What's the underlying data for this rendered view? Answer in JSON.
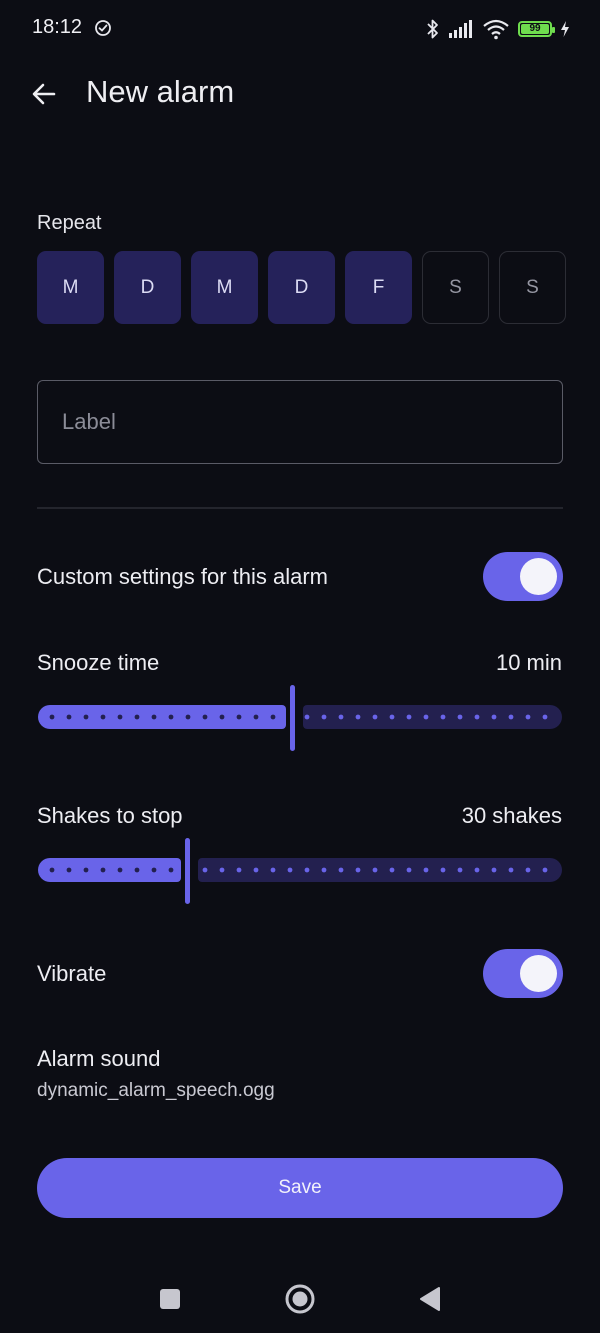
{
  "status_bar": {
    "time": "18:12",
    "battery": "99",
    "icons": [
      "check-circle-icon",
      "bluetooth-icon",
      "signal-icon",
      "wifi-icon",
      "battery-icon",
      "charging-icon"
    ]
  },
  "header": {
    "title": "New alarm",
    "back_icon": "arrow-left-icon"
  },
  "repeat": {
    "label": "Repeat",
    "days": [
      {
        "label": "M",
        "selected": true
      },
      {
        "label": "D",
        "selected": true
      },
      {
        "label": "M",
        "selected": true
      },
      {
        "label": "D",
        "selected": true
      },
      {
        "label": "F",
        "selected": true
      },
      {
        "label": "S",
        "selected": false
      },
      {
        "label": "S",
        "selected": false
      }
    ]
  },
  "label_field": {
    "placeholder": "Label",
    "value": ""
  },
  "custom_settings": {
    "label": "Custom settings for this alarm",
    "enabled": true
  },
  "snooze": {
    "label": "Snooze time",
    "value": "10 min",
    "fraction": 0.5
  },
  "shakes": {
    "label": "Shakes to stop",
    "value": "30 shakes",
    "fraction": 0.3
  },
  "vibrate": {
    "label": "Vibrate",
    "enabled": true
  },
  "alarm_sound": {
    "label": "Alarm sound",
    "file": "dynamic_alarm_speech.ogg"
  },
  "save_button": {
    "label": "Save"
  },
  "nav": {
    "icons": [
      "recents-square-icon",
      "home-circle-icon",
      "back-triangle-icon"
    ]
  },
  "colors": {
    "background": "#0c0d14",
    "accent": "#6964e9",
    "day_selected": "#25225a",
    "track_inactive": "#23204f"
  }
}
